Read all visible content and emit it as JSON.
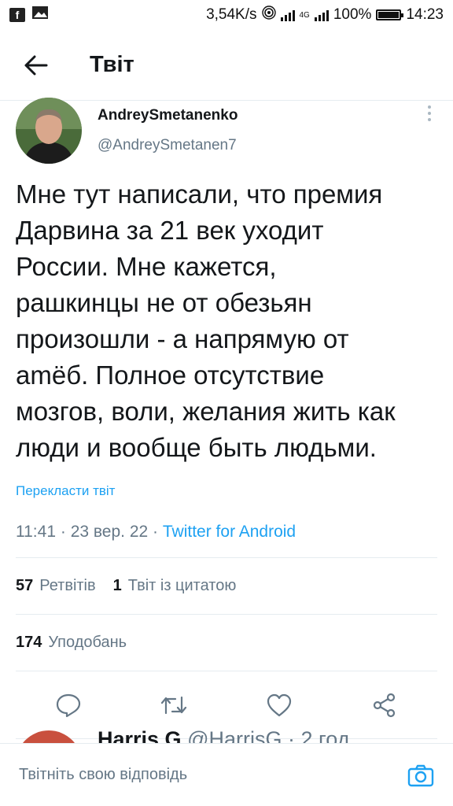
{
  "status_bar": {
    "net_speed": "3,54K/s",
    "network": "4G",
    "battery": "100%",
    "battery_level": 1.0,
    "time": "14:23",
    "icons": [
      "facebook-icon",
      "gallery-icon",
      "hotspot-icon",
      "signal-icon",
      "battery-icon"
    ]
  },
  "header": {
    "back_icon": "arrow-left-icon",
    "title": "Твіт"
  },
  "tweet": {
    "display_name": "AndreySmetanenko",
    "handle": "@AndreySmetanen7",
    "text": "Мне тут написали, что премия\nДарвина за 21 век уходит\nРоссии. Мне кажется,\nрашкинцы не от обезьян\nпроизошли - а напрямую от\namёб. Полное отсутствие\nмозгов, воли, желания жить как\nлюди и вообще быть людьми.",
    "translate_link": "Перекласти твіт",
    "time": "11:41",
    "date": "23 вер. 22",
    "source": "Twitter for Android",
    "separator": "·"
  },
  "stats": {
    "retweets_count": "57",
    "retweets_label": "Ретвітів",
    "quotes_count": "1",
    "quotes_label": "Твіт із цитатою",
    "likes_count": "174",
    "likes_label": "Уподобань"
  },
  "actions": [
    "reply-icon",
    "retweet-icon",
    "like-icon",
    "share-icon"
  ],
  "reply_peek": {
    "name": "Harris G",
    "handle": "@HarrisG",
    "time": "· 2 год"
  },
  "composer": {
    "placeholder": "Твітніть свою відповідь",
    "camera_icon": "camera-icon"
  },
  "colors": {
    "accent": "#1da1f2",
    "text": "#14171a",
    "secondary": "#657786",
    "divider": "#e6ecf0"
  }
}
